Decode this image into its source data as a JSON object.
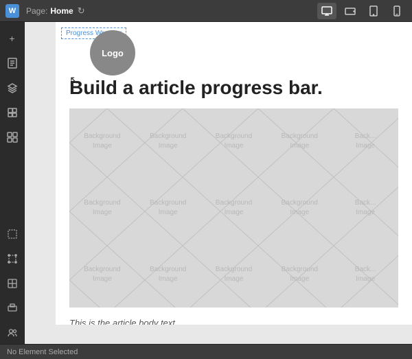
{
  "topbar": {
    "logo": "W",
    "page_label": "Page:",
    "page_name": "Home",
    "refresh_icon": "↻",
    "view_icons": [
      {
        "name": "desktop",
        "active": true
      },
      {
        "name": "tablet-landscape",
        "active": false
      },
      {
        "name": "tablet-portrait",
        "active": false
      },
      {
        "name": "mobile",
        "active": false
      }
    ]
  },
  "sidebar": {
    "top_icons": [
      {
        "name": "add",
        "symbol": "+"
      },
      {
        "name": "pages",
        "symbol": "▭"
      },
      {
        "name": "layers",
        "symbol": "≡"
      },
      {
        "name": "media",
        "symbol": "⬛"
      },
      {
        "name": "apps",
        "symbol": "◫"
      }
    ],
    "bottom_icons": [
      {
        "name": "select-tool",
        "symbol": "⬚"
      },
      {
        "name": "crop-tool",
        "symbol": "⊡"
      },
      {
        "name": "grid-tool",
        "symbol": "⊞"
      },
      {
        "name": "embed-tool",
        "symbol": "⬜"
      },
      {
        "name": "users-tool",
        "symbol": "⚇"
      }
    ]
  },
  "canvas": {
    "selection_label": "Progress Wrapper",
    "logo_text": "Logo",
    "article_title": "Build a article progress bar.",
    "background_image_label": "Background\nImage",
    "bottom_preview_text": "This is the article body text..."
  },
  "statusbar": {
    "text": "No Element Selected"
  }
}
